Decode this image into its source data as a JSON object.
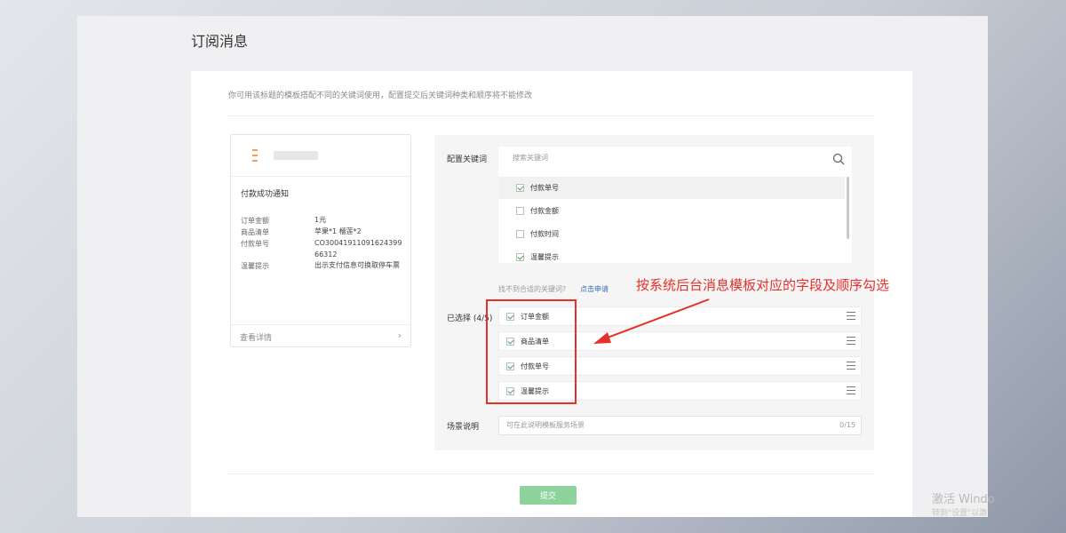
{
  "page": {
    "title": "订阅消息"
  },
  "tip": "你可用该标题的模板搭配不同的关键词使用，配置提交后关键词种类和顺序将不能修改",
  "preview": {
    "title": "付款成功通知",
    "rows": [
      {
        "label": "订单金额",
        "value": "1元"
      },
      {
        "label": "商品清单",
        "value": "苹果*1 榴莲*2"
      },
      {
        "label": "付款单号",
        "value": "CO3004191109162439966312"
      },
      {
        "label": "温馨提示",
        "value": "出示支付信息可换取停车票"
      }
    ],
    "view_details": "查看详情"
  },
  "config": {
    "keywords_label": "配置关键词",
    "search_placeholder": "搜索关键词",
    "keywords": [
      {
        "label": "付款单号",
        "checked": true
      },
      {
        "label": "付款金额",
        "checked": false
      },
      {
        "label": "付款时间",
        "checked": false
      },
      {
        "label": "温馨提示",
        "checked": true
      }
    ],
    "hint": "找不到合适的关键词?",
    "hint_link": "点击申请",
    "selected_label": "已选择 (4/5)",
    "selected": [
      {
        "label": "订单金额"
      },
      {
        "label": "商品清单"
      },
      {
        "label": "付款单号"
      },
      {
        "label": "温馨提示"
      }
    ],
    "scene_label": "场景说明",
    "scene_placeholder": "可在此说明模板服务场景",
    "scene_count": "0/15"
  },
  "submit_label": "提交",
  "annotation": "按系统后台消息模板对应的字段及顺序勾选",
  "watermark": {
    "line1": "激活 Windo",
    "line2": "转到\"设置\"以激"
  },
  "colors": {
    "annotation": "#e4312b",
    "submit": "#8fd39c",
    "checkbox": "#3ea64b"
  }
}
